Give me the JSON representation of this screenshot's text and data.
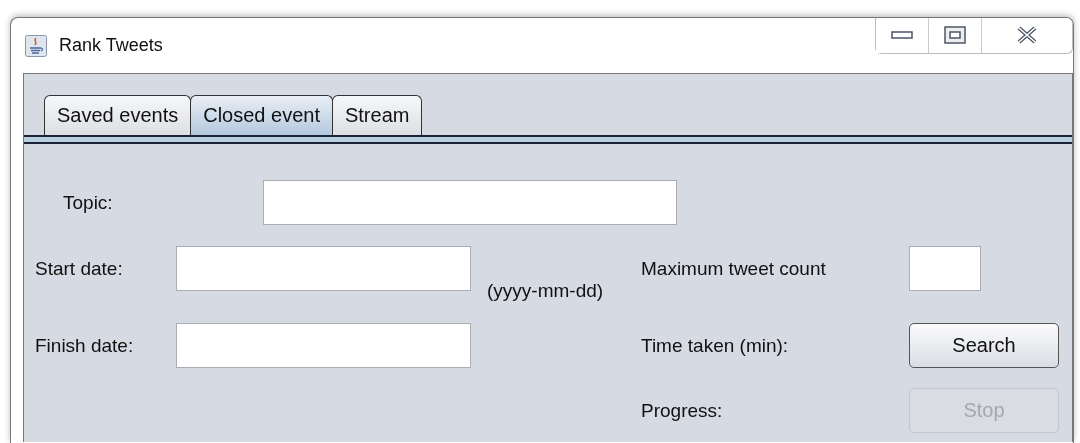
{
  "window": {
    "title": "Rank Tweets"
  },
  "tabs": [
    {
      "label": "Saved events",
      "selected": false
    },
    {
      "label": "Closed event",
      "selected": true
    },
    {
      "label": "Stream",
      "selected": false
    }
  ],
  "form": {
    "topic_label": "Topic:",
    "start_label": "Start date:",
    "date_hint": "(yyyy-mm-dd)",
    "finish_label": "Finish date:",
    "max_count_label": "Maximum tweet count",
    "time_label": "Time taken (min):",
    "progress_label": "Progress:"
  },
  "buttons": [
    {
      "label": "Search",
      "disabled": false
    },
    {
      "label": "Stop",
      "disabled": true
    }
  ]
}
